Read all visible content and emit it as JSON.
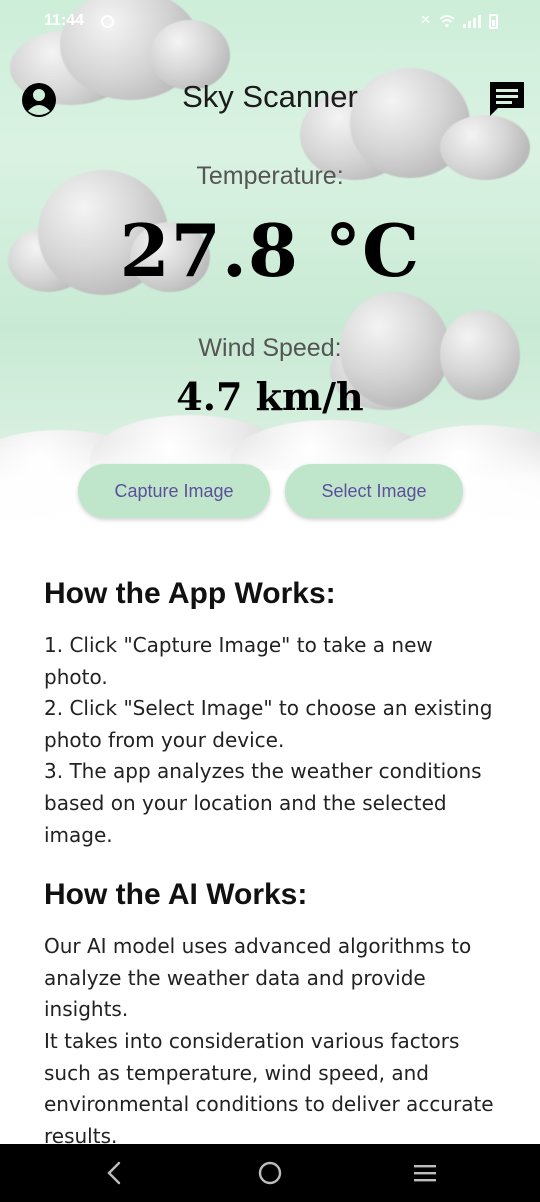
{
  "status_bar": {
    "time": "11:44",
    "icons": [
      "app-notification-icon",
      "mute-icon",
      "wifi-icon",
      "signal-icon",
      "battery-charging-icon"
    ]
  },
  "header": {
    "title": "Sky Scanner",
    "left_icon": "account-circle-icon",
    "right_icon": "chat-message-icon"
  },
  "weather": {
    "temperature_label": "Temperature:",
    "temperature_value": "27.8 °C",
    "wind_label": "Wind Speed:",
    "wind_value": "4.7 km/h"
  },
  "actions": {
    "capture_label": "Capture Image",
    "select_label": "Select Image"
  },
  "how_app_works": {
    "heading": "How the App Works:",
    "lines": [
      "1. Click \"Capture Image\" to take a new",
      "photo.",
      "2. Click \"Select Image\" to choose an existing",
      "photo from your device.",
      "3. The app analyzes the weather conditions",
      "based on your location and the selected",
      "image."
    ]
  },
  "how_ai_works": {
    "heading": "How the AI Works:",
    "lines": [
      "Our AI model uses advanced algorithms to",
      "analyze the weather data and provide",
      "insights.",
      "It takes into consideration various factors",
      "such as temperature, wind speed, and",
      "environmental conditions to deliver accurate",
      "results."
    ]
  },
  "nav_bar": {
    "icons": [
      "back-icon",
      "home-icon",
      "recents-icon"
    ]
  },
  "colors": {
    "button_bg": "#bfe6cb",
    "button_text": "#5d4f9c",
    "hero_green": "#cdeed9",
    "nav_bg": "#000000"
  }
}
